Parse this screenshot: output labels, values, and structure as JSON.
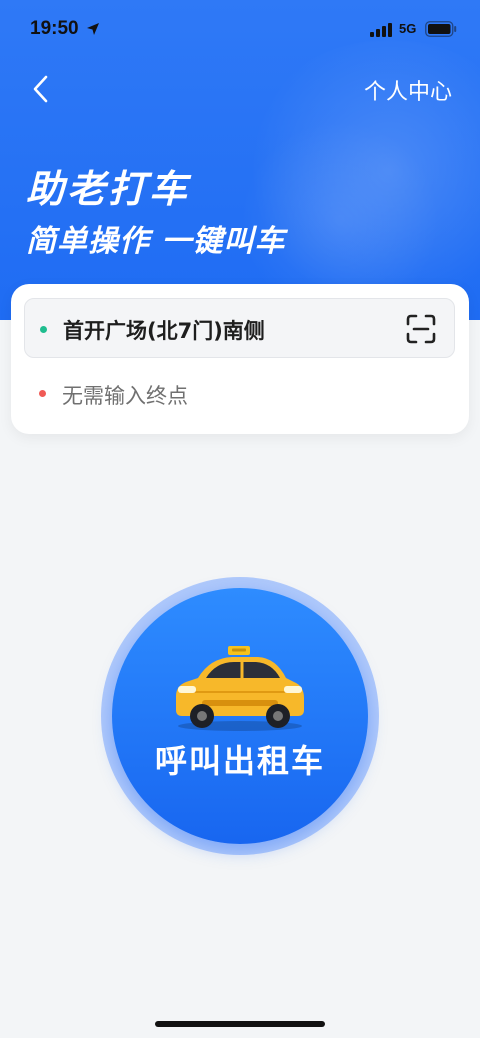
{
  "status_bar": {
    "time": "19:50",
    "network": "5G"
  },
  "header": {
    "back_icon": "chevron-left-icon",
    "personal_center": "个人中心",
    "title": "助老打车",
    "subtitle": "简单操作 一键叫车",
    "background_color": "#2f79f6"
  },
  "route": {
    "start": "首开广场(北7门)南侧",
    "end_placeholder": "无需输入终点",
    "start_dot_color": "#1fbd8f",
    "end_dot_color": "#f05a55",
    "scan_icon": "scan-icon"
  },
  "call_button": {
    "label": "呼叫出租车",
    "icon": "taxi-icon",
    "color": "#1866f0"
  }
}
